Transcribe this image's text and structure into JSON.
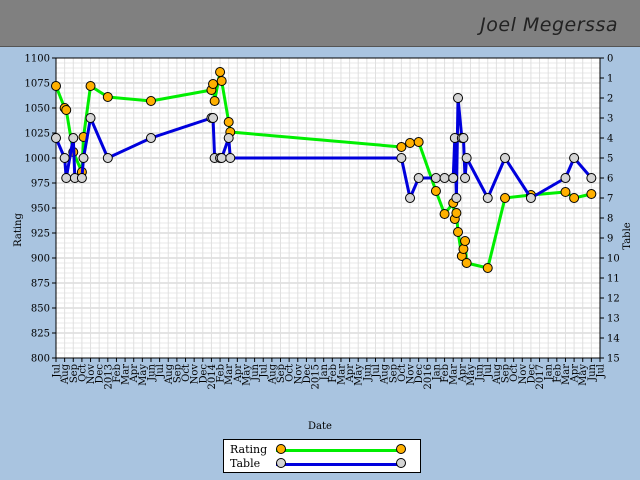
{
  "header": {
    "player_name": "Joel Megerssa"
  },
  "colors": {
    "rating_line": "#00ee00",
    "rating_marker": "#ffb000",
    "table_line": "#0000dd",
    "table_marker": "#d4d4d4",
    "grid": "#d0d0d0",
    "background": "#a9c4e0"
  },
  "chart_data": {
    "type": "line",
    "xlabel": "Date",
    "ylabel": "Rating",
    "y2label": "Table",
    "ylim": [
      800,
      1100
    ],
    "y2lim": [
      0,
      15
    ],
    "y2_inverted": true,
    "grid": true,
    "legend_position": "bottom-center",
    "yticks": [
      "800",
      "825",
      "850",
      "875",
      "900",
      "925",
      "950",
      "975",
      "1000",
      "1025",
      "1050",
      "1075",
      "1100"
    ],
    "y2ticks": [
      "0",
      "1",
      "2",
      "3",
      "4",
      "5",
      "6",
      "7",
      "8",
      "9",
      "10",
      "11",
      "12",
      "13",
      "14",
      "15"
    ],
    "x_ticks": [
      {
        "date": "2012-07",
        "label": "Jul"
      },
      {
        "date": "2012-08",
        "label": "Aug"
      },
      {
        "date": "2012-09",
        "label": "Sep"
      },
      {
        "date": "2012-10",
        "label": "Oct"
      },
      {
        "date": "2012-11",
        "label": "Nov"
      },
      {
        "date": "2012-12",
        "label": "Dec"
      },
      {
        "date": "2013-01",
        "label": "2013"
      },
      {
        "date": "2013-02",
        "label": "Feb"
      },
      {
        "date": "2013-03",
        "label": "Mar"
      },
      {
        "date": "2013-04",
        "label": "Apr"
      },
      {
        "date": "2013-05",
        "label": "May"
      },
      {
        "date": "2013-06",
        "label": "Jun"
      },
      {
        "date": "2013-07",
        "label": "Jul"
      },
      {
        "date": "2013-08",
        "label": "Aug"
      },
      {
        "date": "2013-09",
        "label": "Sep"
      },
      {
        "date": "2013-10",
        "label": "Oct"
      },
      {
        "date": "2013-11",
        "label": "Nov"
      },
      {
        "date": "2013-12",
        "label": "Dec"
      },
      {
        "date": "2014-01",
        "label": "2014"
      },
      {
        "date": "2014-02",
        "label": "Feb"
      },
      {
        "date": "2014-03",
        "label": "Mar"
      },
      {
        "date": "2014-04",
        "label": "Apr"
      },
      {
        "date": "2014-05",
        "label": "May"
      },
      {
        "date": "2014-06",
        "label": "Jun"
      },
      {
        "date": "2014-07",
        "label": "Jul"
      },
      {
        "date": "2014-08",
        "label": "Aug"
      },
      {
        "date": "2014-09",
        "label": "Sep"
      },
      {
        "date": "2014-10",
        "label": "Oct"
      },
      {
        "date": "2014-11",
        "label": "Nov"
      },
      {
        "date": "2014-12",
        "label": "Dec"
      },
      {
        "date": "2015-01",
        "label": "2015"
      },
      {
        "date": "2015-02",
        "label": "Jan"
      },
      {
        "date": "2015-03",
        "label": "Feb"
      },
      {
        "date": "2015-04",
        "label": "Mar"
      },
      {
        "date": "2015-05",
        "label": "Apr"
      },
      {
        "date": "2015-06",
        "label": "May"
      },
      {
        "date": "2015-07",
        "label": "Jun"
      },
      {
        "date": "2015-08",
        "label": "Jul"
      },
      {
        "date": "2015-09",
        "label": "Aug"
      },
      {
        "date": "2015-10",
        "label": "Sep"
      },
      {
        "date": "2015-11",
        "label": "Oct"
      },
      {
        "date": "2015-12",
        "label": "Nov"
      },
      {
        "date": "2016-01",
        "label": "Dec"
      },
      {
        "date": "2016-02",
        "label": "2016"
      },
      {
        "date": "2016-03",
        "label": "Jan"
      },
      {
        "date": "2016-04",
        "label": "Feb"
      },
      {
        "date": "2016-05",
        "label": "Mar"
      },
      {
        "date": "2016-06",
        "label": "Apr"
      },
      {
        "date": "2016-07",
        "label": "May"
      },
      {
        "date": "2016-08",
        "label": "Jun"
      },
      {
        "date": "2016-09",
        "label": "Jul"
      },
      {
        "date": "2016-10",
        "label": "Aug"
      },
      {
        "date": "2016-11",
        "label": "Sep"
      },
      {
        "date": "2016-12",
        "label": "Oct"
      },
      {
        "date": "2017-01",
        "label": "Nov"
      },
      {
        "date": "2017-02",
        "label": "Dec"
      },
      {
        "date": "2017-03",
        "label": "2017"
      },
      {
        "date": "2017-04",
        "label": "Jan"
      },
      {
        "date": "2017-05",
        "label": "Feb"
      },
      {
        "date": "2017-06",
        "label": "Mar"
      },
      {
        "date": "2017-07",
        "label": "Apr"
      },
      {
        "date": "2017-08",
        "label": "May"
      },
      {
        "date": "2017-09",
        "label": "Jun"
      },
      {
        "date": "2017-10",
        "label": "Jul"
      }
    ],
    "x_range": [
      "2012-07",
      "2017-10"
    ],
    "series": [
      {
        "name": "Rating",
        "axis": "left",
        "points": [
          [
            "2012-07",
            1072
          ],
          [
            "2012-08",
            1050
          ],
          [
            "2012-08",
            1048
          ],
          [
            "2012-09",
            1006
          ],
          [
            "2012-10",
            986
          ],
          [
            "2012-10",
            1021
          ],
          [
            "2012-11",
            1072
          ],
          [
            "2013-01",
            1061
          ],
          [
            "2013-06",
            1057
          ],
          [
            "2014-01",
            1068
          ],
          [
            "2014-01",
            1074
          ],
          [
            "2014-01",
            1057
          ],
          [
            "2014-02",
            1086
          ],
          [
            "2014-02",
            1077
          ],
          [
            "2014-03",
            1036
          ],
          [
            "2014-03",
            1026
          ],
          [
            "2015-11",
            1011
          ],
          [
            "2015-12",
            1015
          ],
          [
            "2016-01",
            1016
          ],
          [
            "2016-03",
            967
          ],
          [
            "2016-04",
            944
          ],
          [
            "2016-05",
            955
          ],
          [
            "2016-05",
            939
          ],
          [
            "2016-05",
            945
          ],
          [
            "2016-05",
            926
          ],
          [
            "2016-06",
            902
          ],
          [
            "2016-06",
            909
          ],
          [
            "2016-06",
            917
          ],
          [
            "2016-06",
            895
          ],
          [
            "2016-09",
            890
          ],
          [
            "2016-11",
            960
          ],
          [
            "2017-02",
            963
          ],
          [
            "2017-06",
            966
          ],
          [
            "2017-07",
            960
          ],
          [
            "2017-09",
            964
          ]
        ]
      },
      {
        "name": "Table",
        "axis": "right",
        "points": [
          [
            "2012-07",
            4
          ],
          [
            "2012-08",
            5
          ],
          [
            "2012-08",
            6
          ],
          [
            "2012-09",
            4
          ],
          [
            "2012-09",
            6
          ],
          [
            "2012-10",
            6
          ],
          [
            "2012-10",
            5
          ],
          [
            "2012-11",
            3
          ],
          [
            "2013-01",
            5
          ],
          [
            "2013-06",
            4
          ],
          [
            "2014-01",
            3
          ],
          [
            "2014-01",
            3
          ],
          [
            "2014-01",
            5
          ],
          [
            "2014-02",
            5
          ],
          [
            "2014-02",
            5
          ],
          [
            "2014-03",
            4
          ],
          [
            "2014-03",
            5
          ],
          [
            "2015-11",
            5
          ],
          [
            "2015-12",
            7
          ],
          [
            "2016-01",
            6
          ],
          [
            "2016-03",
            6
          ],
          [
            "2016-04",
            6
          ],
          [
            "2016-05",
            6
          ],
          [
            "2016-05",
            4
          ],
          [
            "2016-05",
            7
          ],
          [
            "2016-05",
            2
          ],
          [
            "2016-06",
            4
          ],
          [
            "2016-06",
            4
          ],
          [
            "2016-06",
            6
          ],
          [
            "2016-06",
            5
          ],
          [
            "2016-09",
            7
          ],
          [
            "2016-11",
            5
          ],
          [
            "2017-02",
            7
          ],
          [
            "2017-06",
            6
          ],
          [
            "2017-07",
            5
          ],
          [
            "2017-09",
            6
          ]
        ]
      }
    ]
  },
  "legend": {
    "rating_label": "Rating",
    "table_label": "Table"
  }
}
